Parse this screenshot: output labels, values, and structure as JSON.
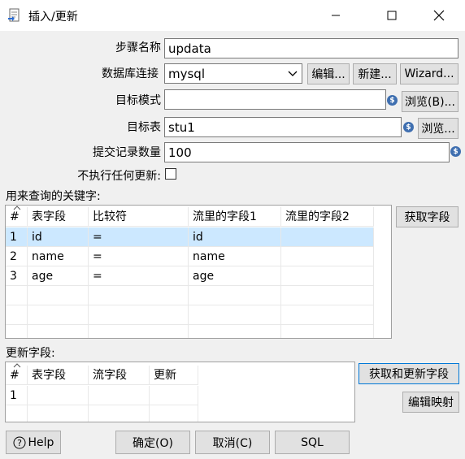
{
  "window": {
    "title": "插入/更新"
  },
  "form": {
    "step_name": {
      "label": "步骤名称",
      "value": "updata"
    },
    "connection": {
      "label": "数据库连接",
      "value": "mysql",
      "edit_btn": "编辑...",
      "new_btn": "新建...",
      "wizard_btn": "Wizard..."
    },
    "schema": {
      "label": "目标模式",
      "value": "",
      "browse_btn": "浏览(B)..."
    },
    "table": {
      "label": "目标表",
      "value": "stu1",
      "browse_btn": "浏览..."
    },
    "commit": {
      "label": "提交记录数量",
      "value": "100"
    },
    "no_update": {
      "label": "不执行任何更新:",
      "checked": false
    }
  },
  "keys": {
    "label": "用来查询的关键字:",
    "get_fields_btn": "获取字段",
    "columns": [
      "#",
      "表字段",
      "比较符",
      "流里的字段1",
      "流里的字段2"
    ],
    "rows": [
      {
        "num": "1",
        "table_field": "id",
        "comparator": "=",
        "stream1": "id",
        "stream2": ""
      },
      {
        "num": "2",
        "table_field": "name",
        "comparator": "=",
        "stream1": "name",
        "stream2": ""
      },
      {
        "num": "3",
        "table_field": "age",
        "comparator": "=",
        "stream1": "age",
        "stream2": ""
      }
    ]
  },
  "update": {
    "label": "更新字段:",
    "get_update_btn": "获取和更新字段",
    "edit_mapping_btn": "编辑映射",
    "columns": [
      "#",
      "表字段",
      "流字段",
      "更新"
    ],
    "rows": [
      {
        "num": "1",
        "table_field": "",
        "stream_field": "",
        "update": ""
      }
    ]
  },
  "footer": {
    "help": "Help",
    "ok": "确定(O)",
    "cancel": "取消(C)",
    "sql": "SQL"
  },
  "colors": {
    "selection": "#cce8ff",
    "accent": "#0078d7",
    "variable_icon": "#3f6fb0"
  }
}
